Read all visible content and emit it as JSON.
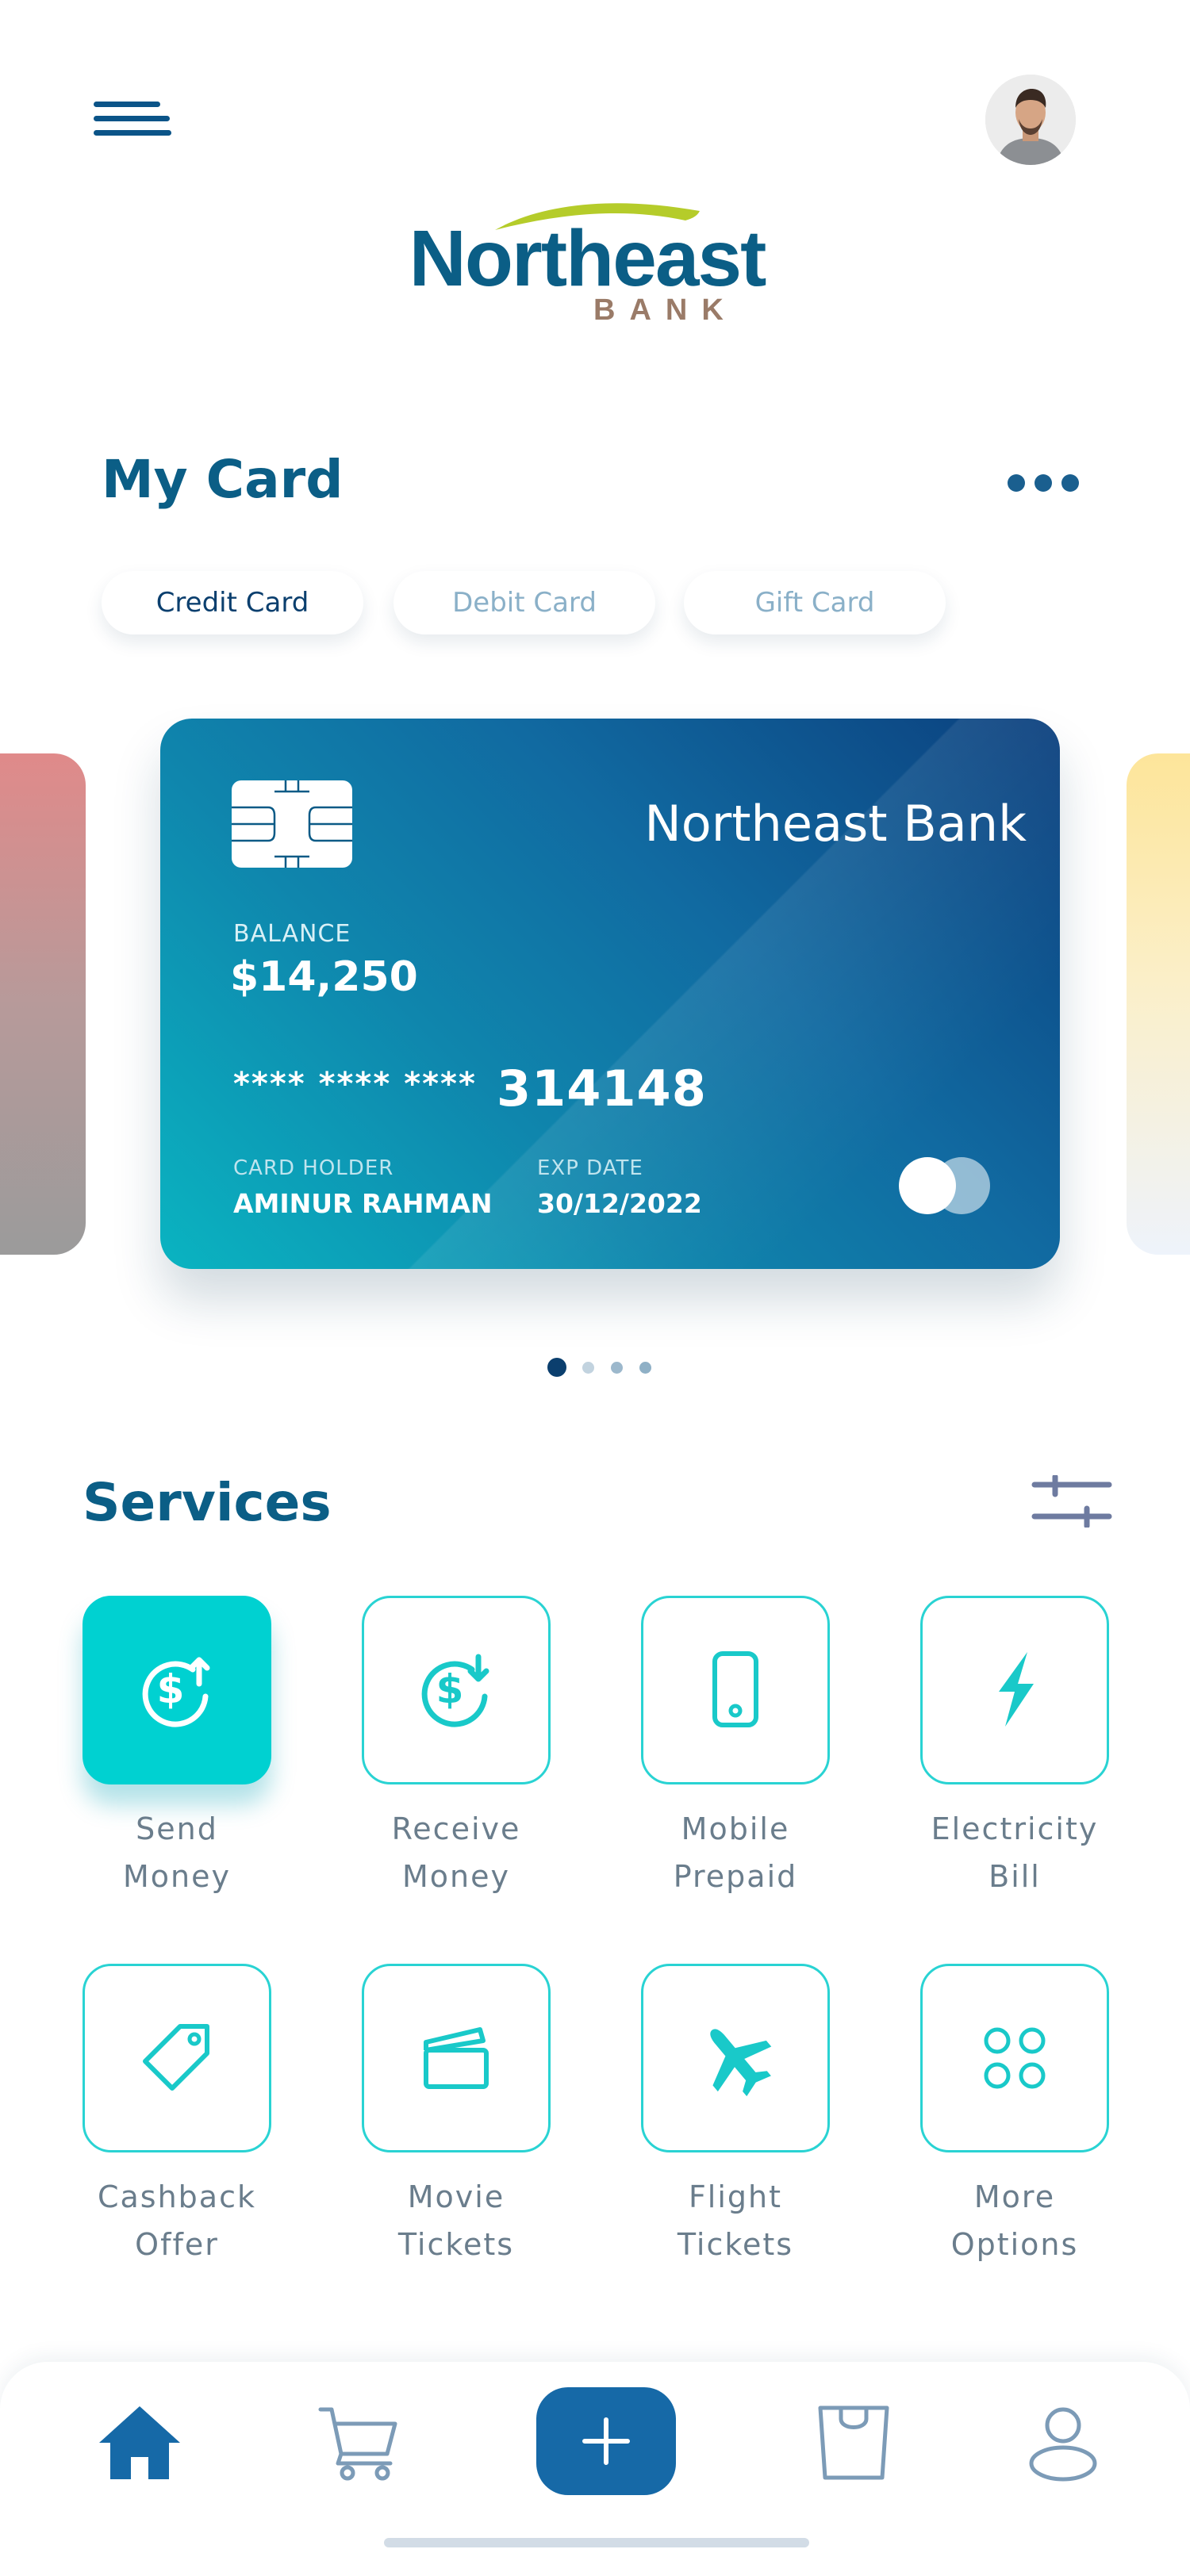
{
  "logo": {
    "name": "Northeast",
    "sub": "BANK"
  },
  "my_card": {
    "title": "My Card",
    "tabs": [
      {
        "label": "Credit Card",
        "active": true
      },
      {
        "label": "Debit Card",
        "active": false
      },
      {
        "label": "Gift Card",
        "active": false
      }
    ]
  },
  "card": {
    "bank_name": "Northeast Bank",
    "balance_label": "BALANCE",
    "balance": "$14,250",
    "number_mask": "**** **** ****",
    "number_last": "314148",
    "holder_label": "CARD HOLDER",
    "holder": "AMINUR RAHMAN",
    "exp_label": "EXP DATE",
    "exp": "30/12/2022"
  },
  "carousel": {
    "count": 4,
    "active_index": 0
  },
  "services": {
    "title": "Services",
    "items": [
      {
        "line1": "Send",
        "line2": "Money",
        "icon": "send-money-icon"
      },
      {
        "line1": "Receive",
        "line2": "Money",
        "icon": "receive-money-icon"
      },
      {
        "line1": "Mobile",
        "line2": "Prepaid",
        "icon": "mobile-icon"
      },
      {
        "line1": "Electricity",
        "line2": "Bill",
        "icon": "lightning-icon"
      },
      {
        "line1": "Cashback",
        "line2": "Offer",
        "icon": "tag-icon"
      },
      {
        "line1": "Movie",
        "line2": "Tickets",
        "icon": "clapperboard-icon"
      },
      {
        "line1": "Flight",
        "line2": "Tickets",
        "icon": "airplane-icon"
      },
      {
        "line1": "More",
        "line2": "Options",
        "icon": "grid-icon"
      }
    ]
  },
  "colors": {
    "primary": "#0b5e86",
    "accent": "#00d1d1",
    "nav_active": "#1669a7"
  }
}
